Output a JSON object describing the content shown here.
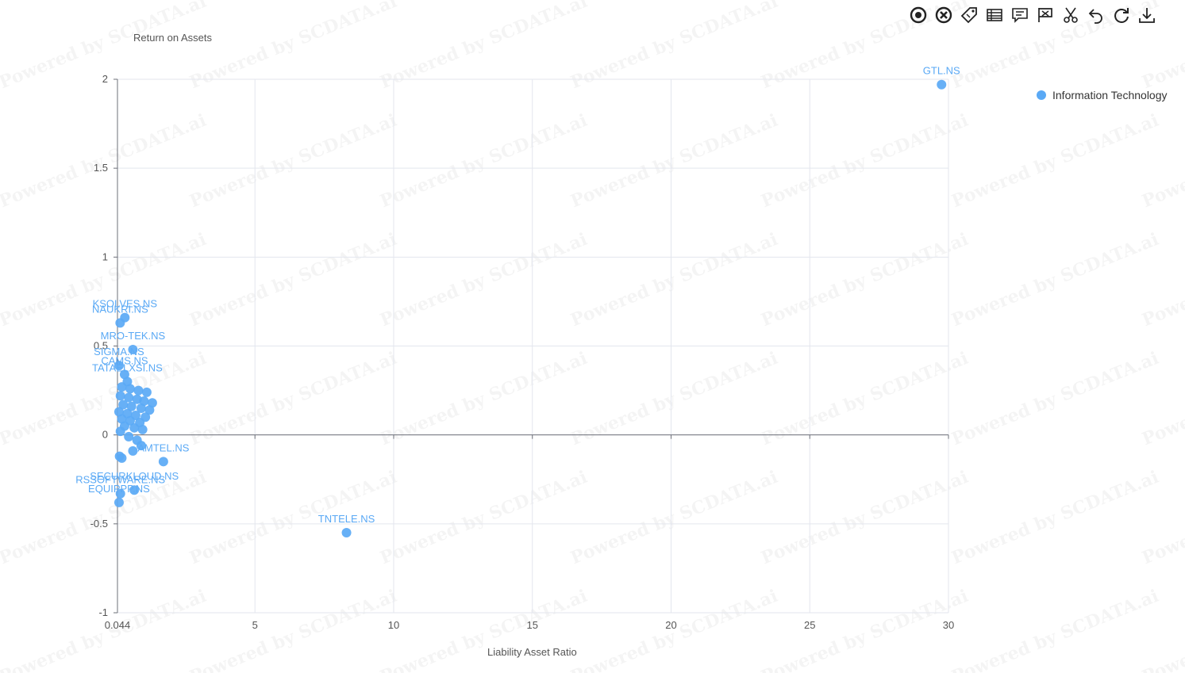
{
  "chart_data": {
    "type": "scatter",
    "xlabel": "Liability Asset Ratio",
    "ylabel": "Return on Assets",
    "xlim": [
      0.044,
      30
    ],
    "ylim": [
      -1,
      2
    ],
    "x_ticks": [
      "0.044",
      "5",
      "10",
      "15",
      "20",
      "25",
      "30"
    ],
    "x_tick_values": [
      0.044,
      5,
      10,
      15,
      20,
      25,
      30
    ],
    "y_ticks": [
      "-1",
      "-0.5",
      "0",
      "0.5",
      "1",
      "1.5",
      "2"
    ],
    "y_tick_values": [
      -1,
      -0.5,
      0,
      0.5,
      1,
      1.5,
      2
    ],
    "grid": true,
    "legend_position": "top-right",
    "series": [
      {
        "name": "Information Technology",
        "color": "#5aa9f5",
        "points": [
          {
            "label": "GTL.NS",
            "x": 29.75,
            "y": 1.97
          },
          {
            "label": "KSOLVES.NS",
            "x": 0.31,
            "y": 0.66
          },
          {
            "label": "NAUKRI.NS",
            "x": 0.14,
            "y": 0.63
          },
          {
            "label": "MRO-TEK.NS",
            "x": 0.6,
            "y": 0.48
          },
          {
            "label": "SIGMA.NS",
            "x": 0.1,
            "y": 0.39
          },
          {
            "label": "CAMS.NS",
            "x": 0.3,
            "y": 0.34
          },
          {
            "label": "TATAELXSI.NS",
            "x": 0.4,
            "y": 0.3
          },
          {
            "label": "",
            "x": 0.2,
            "y": 0.27
          },
          {
            "label": "",
            "x": 0.5,
            "y": 0.26
          },
          {
            "label": "",
            "x": 0.8,
            "y": 0.25
          },
          {
            "label": "",
            "x": 1.1,
            "y": 0.24
          },
          {
            "label": "",
            "x": 0.15,
            "y": 0.22
          },
          {
            "label": "",
            "x": 0.45,
            "y": 0.21
          },
          {
            "label": "",
            "x": 0.75,
            "y": 0.2
          },
          {
            "label": "",
            "x": 1.0,
            "y": 0.19
          },
          {
            "label": "",
            "x": 1.3,
            "y": 0.18
          },
          {
            "label": "",
            "x": 0.25,
            "y": 0.17
          },
          {
            "label": "",
            "x": 0.55,
            "y": 0.16
          },
          {
            "label": "",
            "x": 0.9,
            "y": 0.15
          },
          {
            "label": "",
            "x": 1.2,
            "y": 0.14
          },
          {
            "label": "",
            "x": 0.1,
            "y": 0.13
          },
          {
            "label": "",
            "x": 0.4,
            "y": 0.12
          },
          {
            "label": "",
            "x": 0.7,
            "y": 0.11
          },
          {
            "label": "",
            "x": 1.05,
            "y": 0.1
          },
          {
            "label": "",
            "x": 0.2,
            "y": 0.09
          },
          {
            "label": "",
            "x": 0.5,
            "y": 0.08
          },
          {
            "label": "",
            "x": 0.85,
            "y": 0.07
          },
          {
            "label": "",
            "x": 0.3,
            "y": 0.05
          },
          {
            "label": "",
            "x": 0.65,
            "y": 0.04
          },
          {
            "label": "",
            "x": 0.95,
            "y": 0.03
          },
          {
            "label": "",
            "x": 0.15,
            "y": 0.02
          },
          {
            "label": "",
            "x": 0.45,
            "y": -0.01
          },
          {
            "label": "",
            "x": 0.75,
            "y": -0.03
          },
          {
            "label": "",
            "x": 0.6,
            "y": -0.09
          },
          {
            "label": "",
            "x": 0.9,
            "y": -0.06
          },
          {
            "label": "AMTEL.NS",
            "x": 1.7,
            "y": -0.15
          },
          {
            "label": "",
            "x": 0.12,
            "y": -0.12
          },
          {
            "label": "",
            "x": 0.2,
            "y": -0.13
          },
          {
            "label": "SECURKLOUD.NS",
            "x": 0.65,
            "y": -0.31
          },
          {
            "label": "RSSOFTWARE.NS",
            "x": 0.15,
            "y": -0.33
          },
          {
            "label": "EQUIPPP.NS",
            "x": 0.1,
            "y": -0.38
          },
          {
            "label": "TNTELE.NS",
            "x": 8.3,
            "y": -0.55
          }
        ]
      }
    ]
  },
  "toolbar": [
    {
      "name": "tool-select-icon",
      "glyph": "target"
    },
    {
      "name": "tool-clear-icon",
      "glyph": "xcircle"
    },
    {
      "name": "tool-tag-icon",
      "glyph": "tag"
    },
    {
      "name": "tool-table-icon",
      "glyph": "table"
    },
    {
      "name": "tool-comment-icon",
      "glyph": "comment"
    },
    {
      "name": "tool-flag-icon",
      "glyph": "flag"
    },
    {
      "name": "tool-cut-icon",
      "glyph": "scissors"
    },
    {
      "name": "tool-undo-icon",
      "glyph": "undo"
    },
    {
      "name": "tool-refresh-icon",
      "glyph": "refresh"
    },
    {
      "name": "tool-download-icon",
      "glyph": "download"
    }
  ],
  "watermark": "Powered by SCDATA.ai"
}
